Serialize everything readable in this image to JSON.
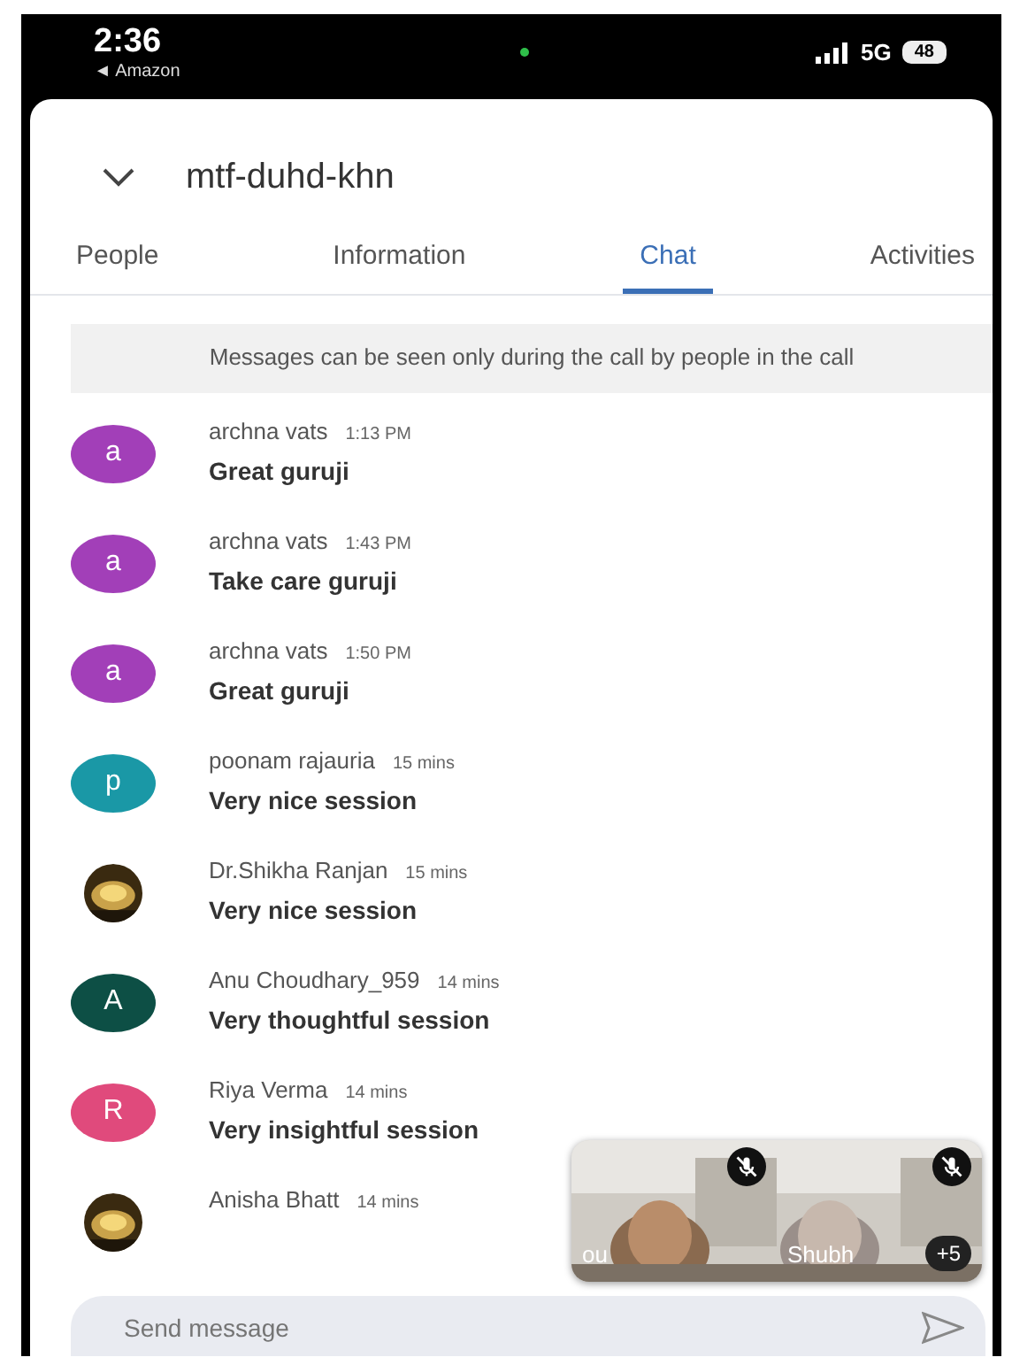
{
  "status_bar": {
    "time": "2:36",
    "back_label": "◄ Amazon",
    "network": "5G",
    "battery": "48"
  },
  "header": {
    "meeting_code": "mtf-duhd-khn"
  },
  "tabs": [
    {
      "label": "People",
      "selected": false
    },
    {
      "label": "Information",
      "selected": false
    },
    {
      "label": "Chat",
      "selected": true
    },
    {
      "label": "Activities",
      "selected": false
    }
  ],
  "notice": "Messages can be seen only during the call by people in the call",
  "messages": [
    {
      "avatar": {
        "kind": "letter",
        "letter": "a",
        "color": "#a23fb8"
      },
      "name": "archna vats",
      "time": "1:13 PM",
      "text": "Great guruji"
    },
    {
      "avatar": {
        "kind": "letter",
        "letter": "a",
        "color": "#a23fb8"
      },
      "name": "archna vats",
      "time": "1:43 PM",
      "text": "Take care guruji"
    },
    {
      "avatar": {
        "kind": "letter",
        "letter": "a",
        "color": "#a23fb8"
      },
      "name": "archna vats",
      "time": "1:50 PM",
      "text": "Great guruji"
    },
    {
      "avatar": {
        "kind": "letter",
        "letter": "p",
        "color": "#1a98a6"
      },
      "name": "poonam rajauria",
      "time": "15 mins",
      "text": "Very nice session"
    },
    {
      "name": "Dr.Shikha Ranjan",
      "time": "15 mins",
      "text": "Very nice session"
    },
    {
      "avatar": {
        "kind": "letter",
        "letter": "A",
        "color": "#0d4f45"
      },
      "name": "Anu Choudhary_959",
      "time": "14 mins",
      "text": "Very thoughtful session"
    },
    {
      "avatar": {
        "kind": "letter",
        "letter": "R",
        "color": "#e04a7c"
      },
      "name": "Riya Verma",
      "time": "14 mins",
      "text": "Very insightful session"
    },
    {
      "name": "Anisha Bhatt",
      "time": "14 mins"
    }
  ],
  "video_tiles": [
    {
      "label": "ou",
      "muted": true
    },
    {
      "label": "Shubh",
      "muted": true,
      "extra_count": "+5"
    }
  ],
  "composer": {
    "placeholder": "Send message"
  }
}
